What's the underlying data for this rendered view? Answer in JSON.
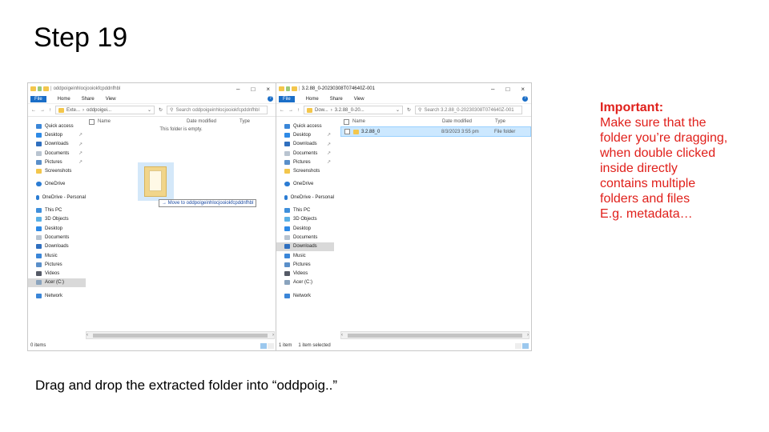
{
  "slide": {
    "title": "Step 19",
    "caption": "Drag and drop the extracted folder into “oddpoig..”",
    "note": {
      "heading": "Important:",
      "lines": [
        "Make sure that the",
        "folder you’re dragging,",
        "when double clicked",
        "inside directly",
        "contains multiple",
        "folders and files",
        "E.g. metadata…"
      ]
    }
  },
  "colors": {
    "note_red": "#e0201b",
    "accent_blue": "#1a6ec7",
    "selection": "#cce8ff"
  },
  "left_window": {
    "title": "oddpoigeinhlocjooiokfcpddnfhbl",
    "ribbon": {
      "file": "File",
      "home": "Home",
      "share": "Share",
      "view": "View"
    },
    "address": {
      "path1": "Exte...",
      "path2": "oddpoigei...",
      "search_placeholder": "Search oddpoigeinhlocjooiokfcpddnfhbl"
    },
    "columns": {
      "name": "Name",
      "date": "Date modified",
      "type": "Type"
    },
    "empty_text": "This folder is empty.",
    "drag_tooltip": "Move to oddpoigeinhlocjooiokfcpddnfhbl",
    "status": "0 items"
  },
  "right_window": {
    "title": "3.2.88_0-20230308T074640Z-001",
    "ribbon": {
      "file": "File",
      "home": "Home",
      "share": "Share",
      "view": "View"
    },
    "address": {
      "path1": "Dow...",
      "path2": "3.2.88_0-20...",
      "search_placeholder": "Search 3.2.88_0-20230308T074640Z-001"
    },
    "columns": {
      "name": "Name",
      "date": "Date modified",
      "type": "Type"
    },
    "row": {
      "name": "3.2.88_0",
      "date": "8/3/2023 3:55 pm",
      "type": "File folder"
    },
    "status_count": "1 item",
    "status_selected": "1 item selected"
  },
  "nav": {
    "quick_access": "Quick access",
    "desktop": "Desktop",
    "downloads": "Downloads",
    "documents": "Documents",
    "pictures": "Pictures",
    "screenshots": "Screenshots",
    "onedrive": "OneDrive",
    "onedrive_personal": "OneDrive - Personal",
    "this_pc": "This PC",
    "objects3d": "3D Objects",
    "music": "Music",
    "videos": "Videos",
    "acer": "Acer (C:)",
    "network": "Network"
  },
  "icons": {
    "quick_access": "star-icon",
    "desktop": "desktop-icon",
    "downloads": "download-arrow-icon",
    "documents": "document-icon",
    "pictures": "picture-icon",
    "folder": "folder-icon",
    "onedrive": "cloud-icon",
    "this_pc": "computer-icon",
    "music": "music-note-icon",
    "videos": "video-icon",
    "drive": "drive-icon",
    "network": "network-icon"
  }
}
